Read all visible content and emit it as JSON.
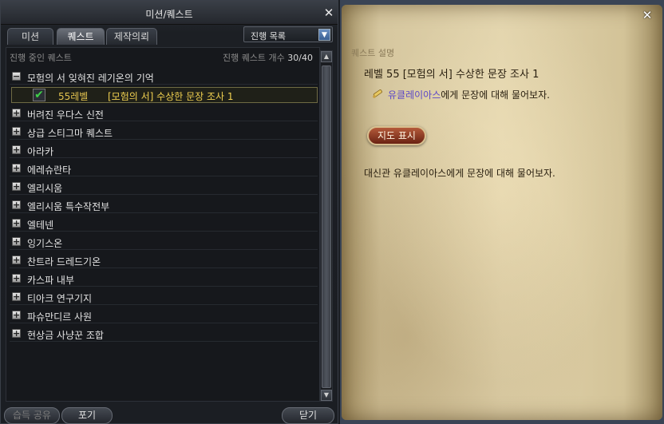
{
  "window": {
    "title": "미션/퀘스트"
  },
  "tabs": [
    {
      "label": "미션",
      "active": false
    },
    {
      "label": "퀘스트",
      "active": true
    },
    {
      "label": "제작의뢰",
      "active": false
    }
  ],
  "filter": {
    "selected": "진행 목록"
  },
  "list_header": {
    "label": "진행 중인 퀘스트",
    "count_label": "진행 퀘스트 개수",
    "count_value": "30/40"
  },
  "quest_groups": [
    {
      "name": "모험의 서 잊혀진 레기온의 기억",
      "expanded": true
    },
    {
      "name": "버려진 우다스 신전",
      "expanded": false
    },
    {
      "name": "상급 스티그마 퀘스트",
      "expanded": false
    },
    {
      "name": "아라카",
      "expanded": false
    },
    {
      "name": "에레슈란타",
      "expanded": false
    },
    {
      "name": "엘리시움",
      "expanded": false
    },
    {
      "name": "엘리시움 특수작전부",
      "expanded": false
    },
    {
      "name": "엘테넨",
      "expanded": false
    },
    {
      "name": "잉기스온",
      "expanded": false
    },
    {
      "name": "찬트라 드레드기온",
      "expanded": false
    },
    {
      "name": "카스파 내부",
      "expanded": false
    },
    {
      "name": "티아크 연구기지",
      "expanded": false
    },
    {
      "name": "파슈만디르 사원",
      "expanded": false
    },
    {
      "name": "현상금 사냥꾼 조합",
      "expanded": false
    }
  ],
  "selected_quest": {
    "level": "55레벨",
    "name": "[모험의 서] 수상한 문장 조사 1",
    "checked": true
  },
  "bottom_buttons": {
    "share": "습득 공유",
    "abandon": "포기",
    "close": "닫기"
  },
  "detail": {
    "section_label": "퀘스트 설명",
    "title": "레벨 55 [모험의 서] 수상한 문장 조사 1",
    "objective_npc": "유클레이아스",
    "objective_rest": "에게 문장에 대해 물어보자.",
    "map_button": "지도 표시",
    "description": "대신관 유클레이아스에게 문장에 대해 물어보자."
  },
  "colors": {
    "quest_name": "#f0d050",
    "npc_highlight": "#5b47c8",
    "check": "#3fd048"
  }
}
